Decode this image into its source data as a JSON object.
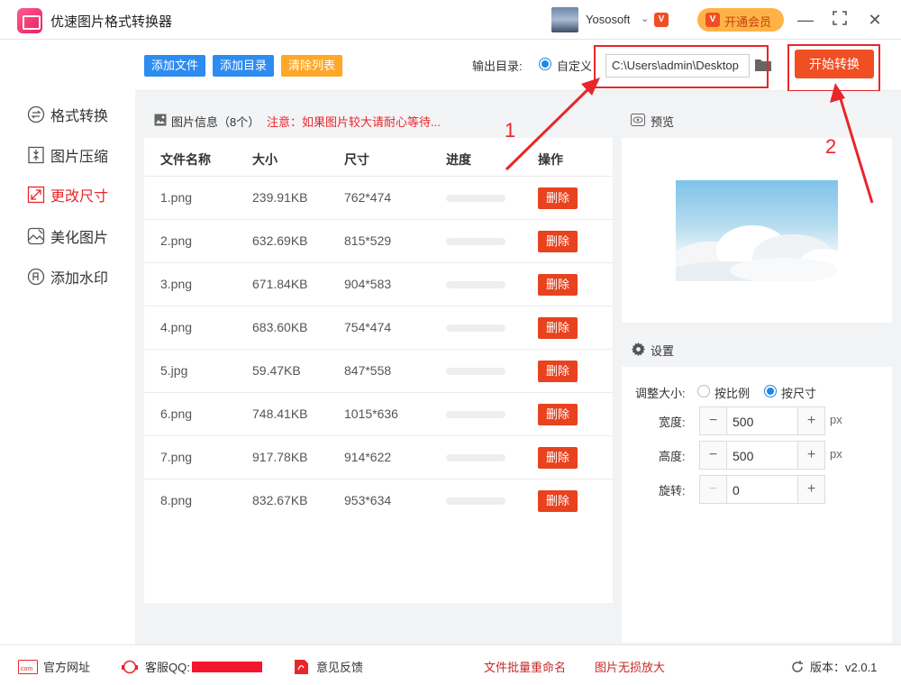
{
  "app": {
    "title": "优速图片格式转换器"
  },
  "titlebar": {
    "user_name": "Yososoft",
    "vip_label": "开通会员"
  },
  "sidebar": {
    "items": [
      {
        "label": "格式转换",
        "icon": "format-convert-icon",
        "active": false
      },
      {
        "label": "图片压缩",
        "icon": "compress-icon",
        "active": false
      },
      {
        "label": "更改尺寸",
        "icon": "resize-icon",
        "active": true
      },
      {
        "label": "美化图片",
        "icon": "beautify-icon",
        "active": false
      },
      {
        "label": "添加水印",
        "icon": "watermark-icon",
        "active": false
      }
    ]
  },
  "toolbar": {
    "add_file": "添加文件",
    "add_dir": "添加目录",
    "clear_list": "清除列表",
    "output_label": "输出目录:",
    "custom_label": "自定义",
    "output_path": "C:\\Users\\admin\\Desktop",
    "start_label": "开始转换"
  },
  "file_list": {
    "title": "图片信息（8个）",
    "notice": "注意：如果图片较大请耐心等待...",
    "columns": [
      "文件名称",
      "大小",
      "尺寸",
      "进度",
      "操作"
    ],
    "delete_label": "删除",
    "rows": [
      {
        "name": "1.png",
        "size": "239.91KB",
        "dim": "762*474",
        "progress": 0
      },
      {
        "name": "2.png",
        "size": "632.69KB",
        "dim": "815*529",
        "progress": 0
      },
      {
        "name": "3.png",
        "size": "671.84KB",
        "dim": "904*583",
        "progress": 0
      },
      {
        "name": "4.png",
        "size": "683.60KB",
        "dim": "754*474",
        "progress": 0
      },
      {
        "name": "5.jpg",
        "size": "59.47KB",
        "dim": "847*558",
        "progress": 0
      },
      {
        "name": "6.png",
        "size": "748.41KB",
        "dim": "1015*636",
        "progress": 0
      },
      {
        "name": "7.png",
        "size": "917.78KB",
        "dim": "914*622",
        "progress": 0
      },
      {
        "name": "8.png",
        "size": "832.67KB",
        "dim": "953*634",
        "progress": 0
      }
    ]
  },
  "preview": {
    "title": "预览"
  },
  "settings": {
    "title": "设置",
    "resize_label": "调整大小:",
    "by_ratio": "按比例",
    "by_size": "按尺寸",
    "width_label": "宽度:",
    "width_value": "500",
    "height_label": "高度:",
    "height_value": "500",
    "rotate_label": "旋转:",
    "rotate_value": "0",
    "unit": "px"
  },
  "annotations": {
    "one": "1",
    "two": "2"
  },
  "footer": {
    "website": "官方网址",
    "qq": "客服QQ:",
    "feedback": "意见反馈",
    "batch_rename": "文件批量重命名",
    "lossless": "图片无损放大",
    "version": "版本：v2.0.1"
  },
  "colors": {
    "accent_red": "#e8262b",
    "start_button": "#f04e23",
    "add_file_button": "#2d8cf0",
    "clear_button": "#ffa726",
    "radio_blue": "#1e88e5"
  }
}
